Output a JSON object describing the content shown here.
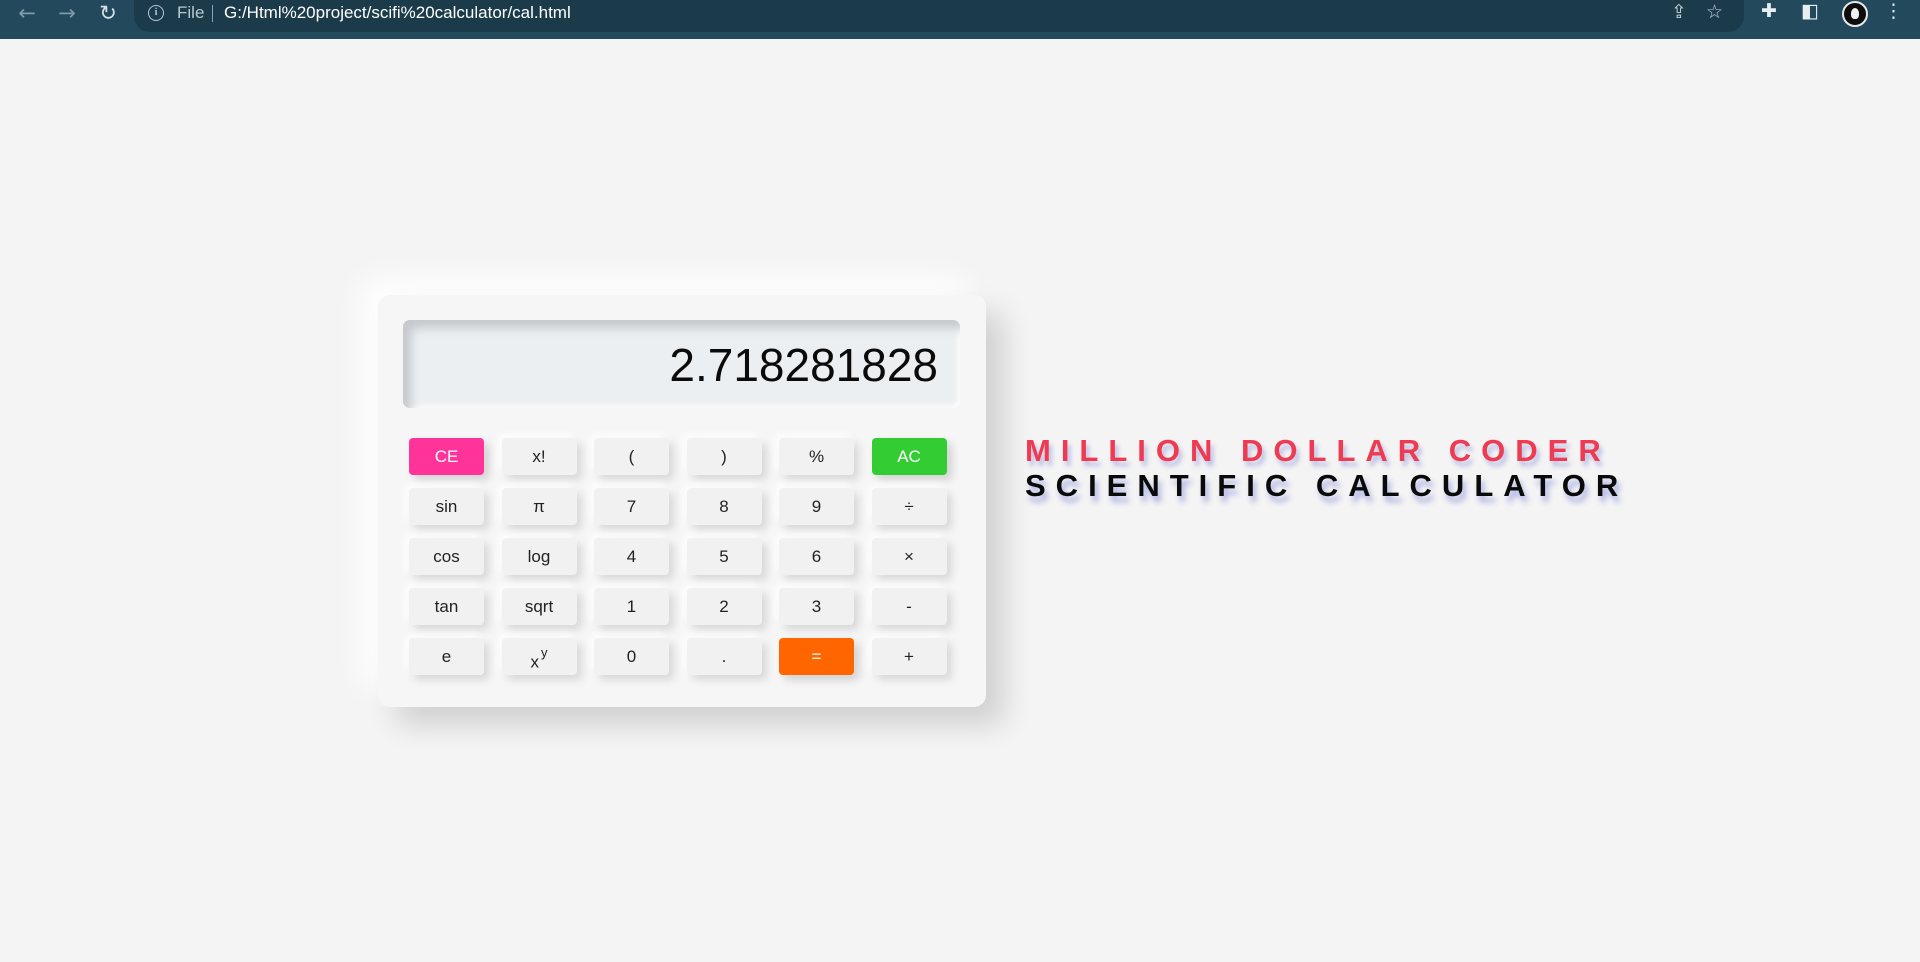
{
  "browser": {
    "back_icon": "←",
    "forward_icon": "→",
    "reload_icon": "↻",
    "info_icon": "i",
    "file_label": "File",
    "url": "G:/Html%20project/scifi%20calculator/cal.html",
    "share_icon": "⇪",
    "bookmark_icon": "☆",
    "extensions_icon": "✚",
    "sidepanel_icon": "◧",
    "menu_icon": "⋮"
  },
  "calculator": {
    "display": "2.718281828",
    "keys": [
      {
        "label": "CE"
      },
      {
        "label": "x!"
      },
      {
        "label": "("
      },
      {
        "label": ")"
      },
      {
        "label": "%"
      },
      {
        "label": "AC"
      },
      {
        "label": "sin"
      },
      {
        "label": "π"
      },
      {
        "label": "7"
      },
      {
        "label": "8"
      },
      {
        "label": "9"
      },
      {
        "label": "÷"
      },
      {
        "label": "cos"
      },
      {
        "label": "log"
      },
      {
        "label": "4"
      },
      {
        "label": "5"
      },
      {
        "label": "6"
      },
      {
        "label": "×"
      },
      {
        "label": "tan"
      },
      {
        "label": "sqrt"
      },
      {
        "label": "1"
      },
      {
        "label": "2"
      },
      {
        "label": "3"
      },
      {
        "label": "-"
      },
      {
        "label": "e"
      },
      {
        "label": "x",
        "sup": "y"
      },
      {
        "label": "0"
      },
      {
        "label": "."
      },
      {
        "label": "="
      },
      {
        "label": "+"
      }
    ]
  },
  "title": {
    "line1": "MILLION DOLLAR CODER",
    "line2": "SCIENTIFIC CALCULATOR"
  },
  "colors": {
    "ce": "#ff3399",
    "ac": "#33cc33",
    "equals": "#ff6600",
    "title_accent": "#ee3b52",
    "browser_bar": "#234a5c"
  }
}
